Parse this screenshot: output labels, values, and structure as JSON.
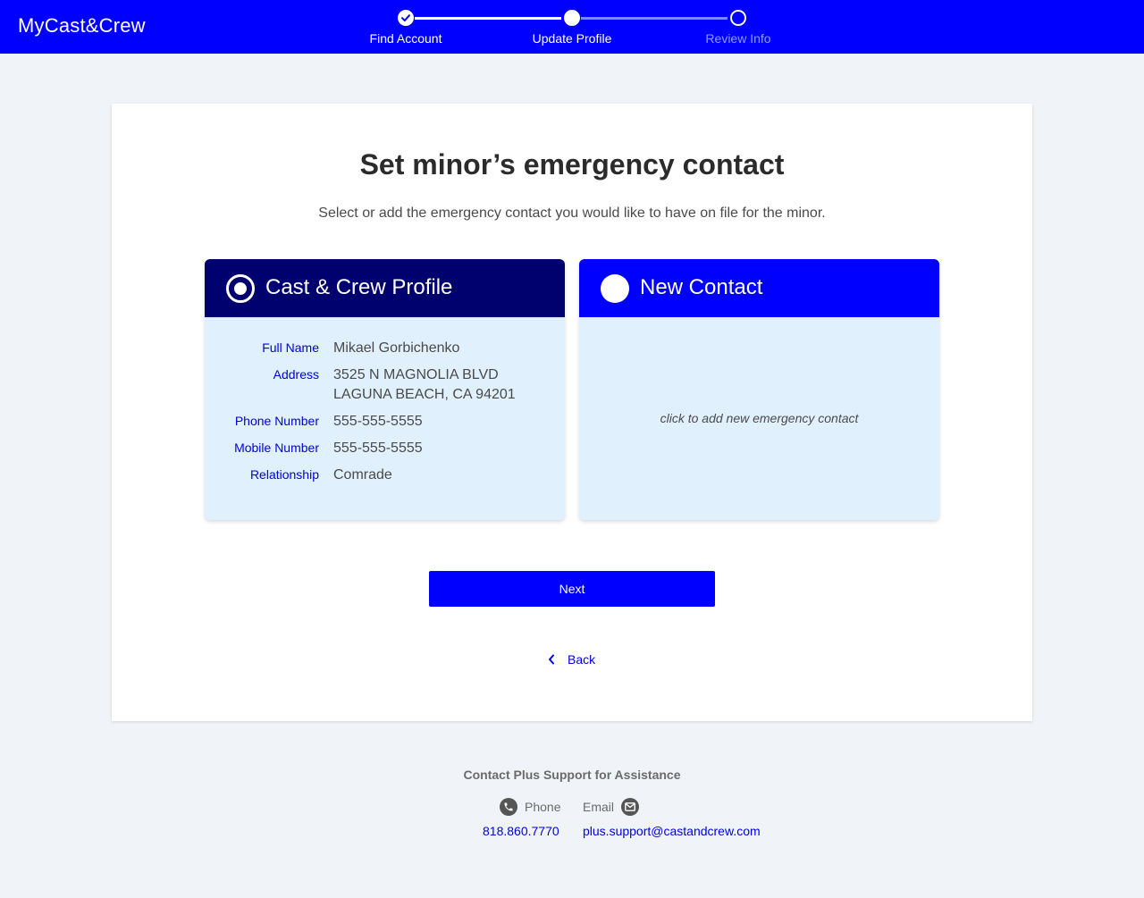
{
  "header": {
    "logo": "MyCast&Crew",
    "steps": [
      {
        "label": "Find Account",
        "state": "complete"
      },
      {
        "label": "Update Profile",
        "state": "current"
      },
      {
        "label": "Review Info",
        "state": "upcoming"
      }
    ]
  },
  "main": {
    "title": "Set minor’s emergency contact",
    "subtitle": "Select or add the emergency contact you would like to have on file for the minor.",
    "options": [
      {
        "title": "Cast & Crew Profile",
        "selected": true,
        "fields": [
          {
            "label": "Full Name",
            "value": "Mikael Gorbichenko"
          },
          {
            "label": "Address",
            "value_line1": "3525 N MAGNOLIA BLVD",
            "value_line2": "LAGUNA BEACH, CA 94201"
          },
          {
            "label": "Phone Number",
            "value": "555-555-5555"
          },
          {
            "label": "Mobile Number",
            "value": "555-555-5555"
          },
          {
            "label": "Relationship",
            "value": "Comrade"
          }
        ]
      },
      {
        "title": "New Contact",
        "selected": false,
        "hint": "click to add new emergency contact"
      }
    ],
    "next_label": "Next",
    "back_label": "Back"
  },
  "footer": {
    "support_title": "Contact Plus Support for Assistance",
    "phone_label": "Phone",
    "phone_number": "818.860.7770",
    "email_label": "Email",
    "email_address": "plus.support@castandcrew.com"
  },
  "colors": {
    "brand_blue": "#0000ff",
    "selected_navy": "#00006e",
    "card_tint": "#e1f0fd",
    "page_bg": "#f0f4f8"
  },
  "icons": [
    "checkmark-icon",
    "chevron-left-icon",
    "phone-icon",
    "email-icon"
  ]
}
